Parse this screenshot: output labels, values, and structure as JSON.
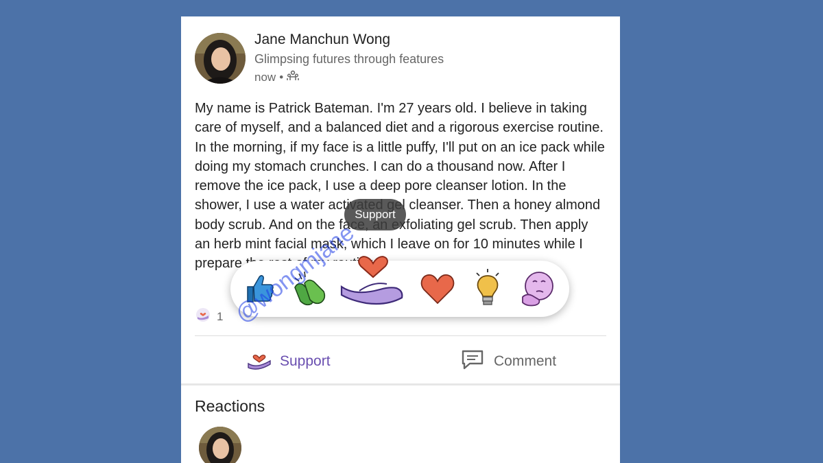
{
  "post": {
    "author_name": "Jane Manchun Wong",
    "author_tagline": "Glimpsing futures through features",
    "timestamp": "now",
    "meta_separator": "•",
    "visibility_icon": "connections-icon",
    "body": "My name is Patrick Bateman. I'm 27 years old. I believe in taking care of myself, and a balanced diet and a rigorous exercise routine. In the morning, if my face is a little puffy, I'll put on an ice pack while doing my stomach crunches. I can do a thousand now. After I remove the ice pack, I use a deep pore cleanser lotion. In the shower, I use a water activated gel cleanser. Then a honey almond body scrub. And on the face, an exfoliating gel scrub. Then apply an herb mint facial mask, which I leave on for 10 minutes while I prepare the rest of my routine."
  },
  "reaction_picker": {
    "tooltip": "Support",
    "reactions": [
      {
        "name": "Like",
        "icon": "thumbs-up-icon",
        "color": "#2a87cc"
      },
      {
        "name": "Celebrate",
        "icon": "clapping-hands-icon",
        "color": "#56a83a"
      },
      {
        "name": "Support",
        "icon": "heart-in-hand-icon",
        "color": "#a88ad6"
      },
      {
        "name": "Love",
        "icon": "heart-icon",
        "color": "#e8684a"
      },
      {
        "name": "Insightful",
        "icon": "lightbulb-icon",
        "color": "#e8b84a"
      },
      {
        "name": "Curious",
        "icon": "thinking-face-icon",
        "color": "#d9a8e8"
      }
    ]
  },
  "reaction_summary": {
    "count": "1",
    "icon": "support-reaction-icon"
  },
  "actions": {
    "support_label": "Support",
    "comment_label": "Comment"
  },
  "reactions_section": {
    "heading": "Reactions"
  },
  "watermark": "@wongmjane",
  "colors": {
    "background": "#4c72a8",
    "accent": "#6a4fb0"
  }
}
